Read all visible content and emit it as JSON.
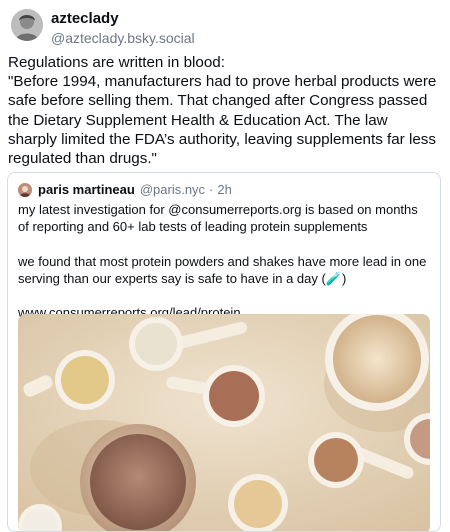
{
  "author": {
    "display_name": "azteclady",
    "handle": "@azteclady.bsky.social"
  },
  "post_text": "Regulations are written in blood:\n\"Before 1994, manufacturers had to prove herbal products were safe before selling them. That changed after Congress passed the Dietary Supplement Health & Education Act. The law sharply limited the FDA’s authority, leaving supplements far less regulated than drugs.\"",
  "quoted_post": {
    "display_name": "paris martineau",
    "handle": "@paris.nyc",
    "separator": "·",
    "time": "2h",
    "text": "my latest investigation for @consumerreports.org is based on months of reporting and 60+ lab tests of leading protein supplements\n\nwe found that most protein powders and shakes have more lead in one serving than our experts say is safe to have in a day (🧪)\n\nwww.consumerreports.org/lead/protein...",
    "image_subject": "protein powders and shakes"
  },
  "colors": {
    "text": "#0b0f14",
    "muted": "#6b7785",
    "border": "#d4dbe2"
  }
}
